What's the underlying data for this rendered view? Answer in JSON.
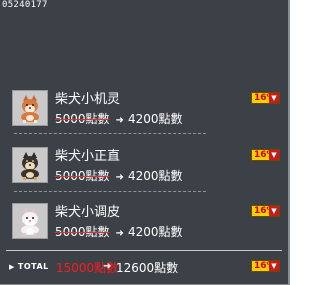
{
  "item_code": "05240177",
  "colors": {
    "panel_bg": "#3c4148",
    "badge_bg": "#f6d000",
    "badge_text": "#d40000",
    "strike": "#e03030",
    "total_old": "#ff1a1a"
  },
  "items": [
    {
      "name": "柴犬小机灵",
      "old_price": "5000點數",
      "new_price": "4200點數",
      "discount": "16%",
      "icon": "shiba-orange-pet-icon"
    },
    {
      "name": "柴犬小正直",
      "old_price": "5000點數",
      "new_price": "4200點數",
      "discount": "16%",
      "icon": "shiba-black-pet-icon"
    },
    {
      "name": "柴犬小调皮",
      "old_price": "5000點數",
      "new_price": "4200點數",
      "discount": "16%",
      "icon": "shiba-white-pet-icon"
    }
  ],
  "total": {
    "label": "TOTAL",
    "old_price": "15000點數",
    "new_price": "12600點數",
    "discount": "16%"
  }
}
